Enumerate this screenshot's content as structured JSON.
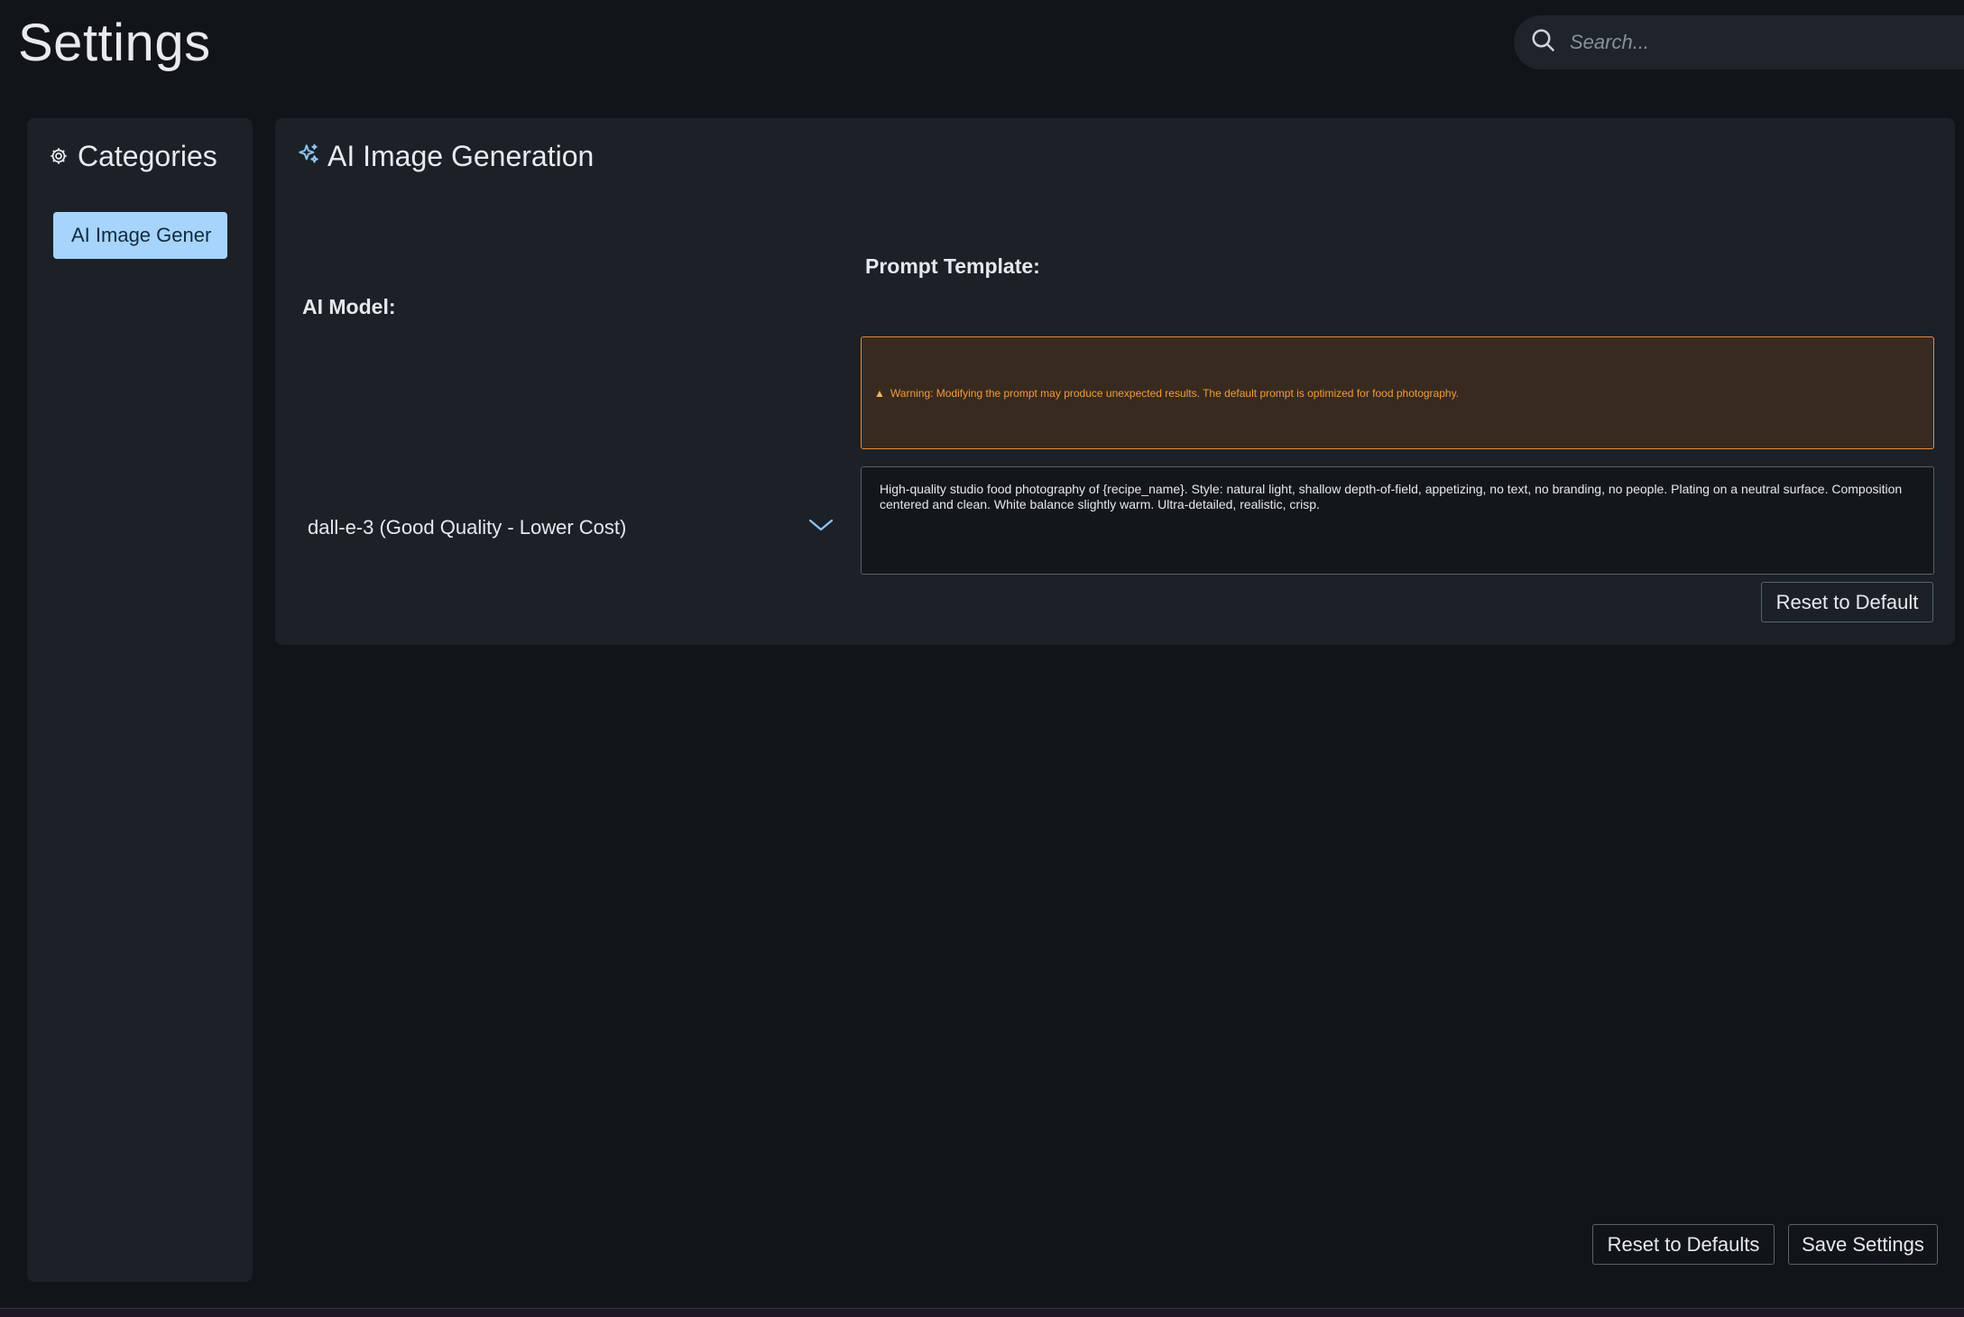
{
  "page": {
    "title": "Settings"
  },
  "search": {
    "placeholder": "Search..."
  },
  "sidebar": {
    "title": "Categories",
    "items": [
      {
        "label": "AI Image Gener",
        "active": true
      }
    ]
  },
  "section": {
    "title": "AI Image Generation",
    "model_label": "AI Model:",
    "model_value": "dall-e-3 (Good Quality - Lower Cost)",
    "prompt_label": "Prompt Template:",
    "warning_text": "Warning: Modifying the prompt may produce unexpected results. The default prompt is optimized for food photography.",
    "prompt_value": "High-quality studio food photography of {recipe_name}. Style: natural light, shallow depth-of-field, appetizing, no text, no branding, no people. Plating on a neutral surface. Composition centered and clean. White balance slightly warm. Ultra-detailed, realistic, crisp.",
    "reset_button": "Reset to Default"
  },
  "footer": {
    "reset_defaults_button": "Reset to Defaults",
    "save_button": "Save Settings"
  },
  "colors": {
    "background": "#11151a",
    "panel": "#1c2128",
    "accent": "#a6d4fa",
    "warning": "#f29b3a"
  },
  "icons": [
    "search-icon",
    "gear-icon",
    "sparkles-icon",
    "chevron-down-icon",
    "warning-icon"
  ]
}
